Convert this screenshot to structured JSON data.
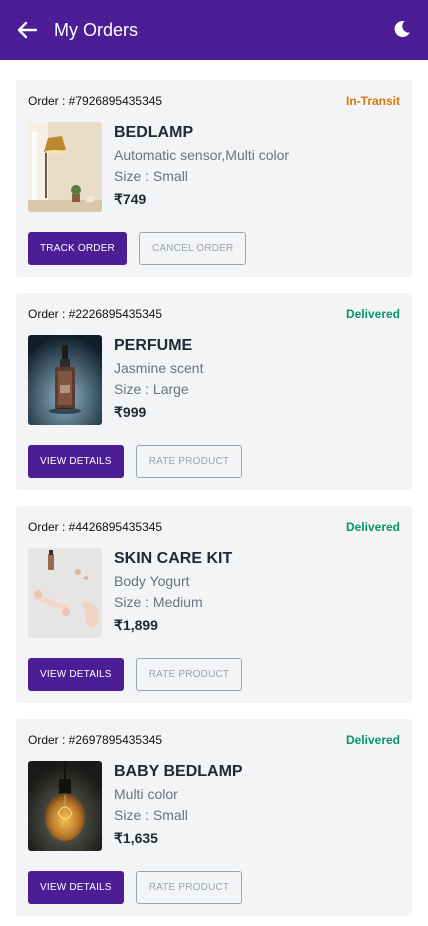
{
  "header": {
    "title": "My Orders",
    "back_icon": "arrow-left-icon",
    "theme_icon": "moon-icon"
  },
  "colors": {
    "primary": "#4c1d95",
    "in_transit": "#d97706",
    "delivered": "#059669"
  },
  "orders": [
    {
      "order_label": "Order : #7926895435345",
      "status": "In-Transit",
      "name": "BEDLAMP",
      "description": "Automatic sensor,Multi color",
      "size": "Size : Small",
      "price": "₹749",
      "primary_action": "TRACK ORDER",
      "secondary_action": "CANCEL ORDER"
    },
    {
      "order_label": "Order : #2226895435345",
      "status": "Delivered",
      "name": "PERFUME",
      "description": "Jasmine scent",
      "size": "Size : Large",
      "price": "₹999",
      "primary_action": "VIEW DETAILS",
      "secondary_action": "RATE PRODUCT"
    },
    {
      "order_label": "Order : #4426895435345",
      "status": "Delivered",
      "name": "SKIN CARE KIT",
      "description": "Body Yogurt",
      "size": "Size : Medium",
      "price": "₹1,899",
      "primary_action": "VIEW DETAILS",
      "secondary_action": "RATE PRODUCT"
    },
    {
      "order_label": "Order : #2697895435345",
      "status": "Delivered",
      "name": "BABY BEDLAMP",
      "description": "Multi color",
      "size": "Size : Small",
      "price": "₹1,635",
      "primary_action": "VIEW DETAILS",
      "secondary_action": "RATE PRODUCT"
    }
  ]
}
